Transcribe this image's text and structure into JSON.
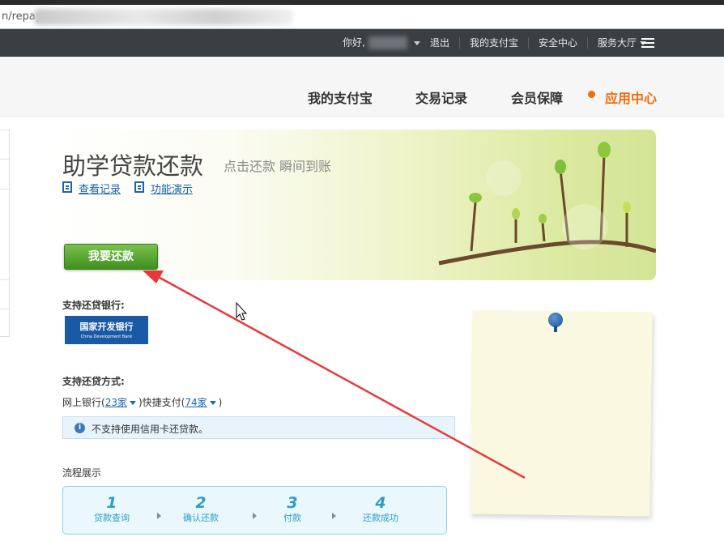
{
  "browser": {
    "url_visible": "n/repay"
  },
  "topbar": {
    "greeting": "你好,",
    "logout": "退出",
    "my_alipay": "我的支付宝",
    "security": "安全中心",
    "service_hall": "服务大厅"
  },
  "subnav": {
    "items": [
      {
        "label": "我的支付宝"
      },
      {
        "label": "交易记录"
      },
      {
        "label": "会员保障"
      },
      {
        "label": "应用中心",
        "active": true
      }
    ]
  },
  "banner": {
    "title": "助学贷款还款",
    "subtitle": "点击还款 瞬间到账",
    "link_records": "查看记录",
    "link_demo": "功能演示",
    "repay_button": "我要还款"
  },
  "banks": {
    "label": "支持还贷银行:",
    "logo_cn": "国家开发银行",
    "logo_en": "China Development Bank"
  },
  "methods": {
    "label": "支持还贷方式:",
    "online_bank_prefix": "网上银行(",
    "online_bank_count": "23家",
    "middle": ")快捷支付(",
    "quick_pay_count": "74家",
    "suffix": ")"
  },
  "notice": {
    "text": "不支持使用信用卡还贷款。"
  },
  "flow": {
    "title": "流程展示",
    "steps": [
      {
        "num": "1",
        "label": "贷款查询"
      },
      {
        "num": "2",
        "label": "确认还款"
      },
      {
        "num": "3",
        "label": "付款"
      },
      {
        "num": "4",
        "label": "还款成功"
      }
    ]
  },
  "colors": {
    "accent": "#f06b0a",
    "link": "#1d63ad",
    "button": "#4f9e2a",
    "annotation_arrow": "#e8383a"
  }
}
